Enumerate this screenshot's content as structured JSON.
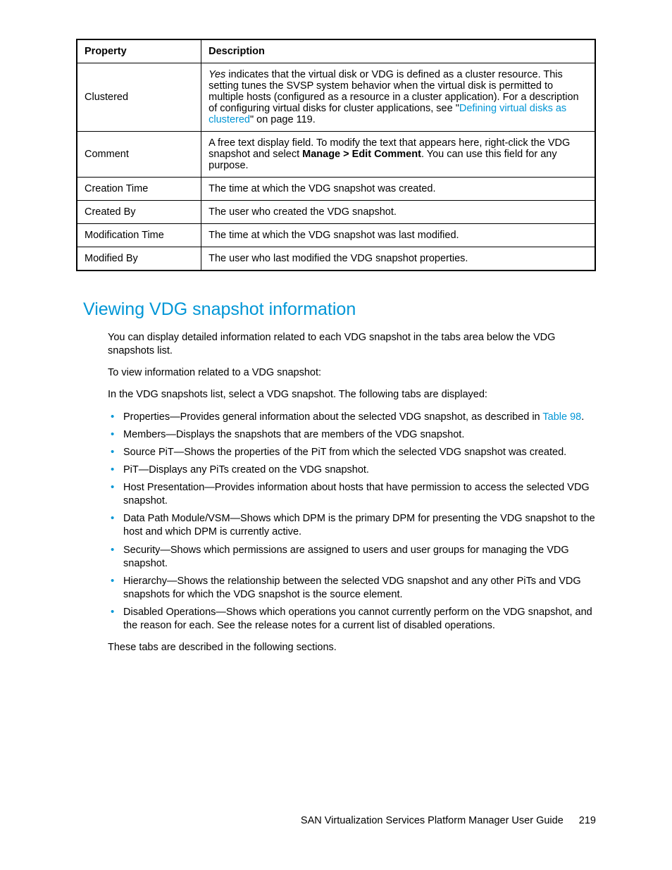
{
  "table": {
    "headers": {
      "property": "Property",
      "description": "Description"
    },
    "rows": [
      {
        "property": "Clustered",
        "desc_pre_italic": "Yes",
        "desc_pre": " indicates that the virtual disk or VDG is defined as a cluster resource. This setting tunes the SVSP system behavior when the virtual disk is permitted to multiple hosts (configured as a resource in a cluster application). For a description of configuring virtual disks for cluster applications, see \"",
        "desc_link": "Defining virtual disks as clustered",
        "desc_post": "\" on page 119."
      },
      {
        "property": "Comment",
        "desc_pre": "A free text display field. To modify the text that appears here, right-click the VDG snapshot and select ",
        "desc_bold": "Manage > Edit Comment",
        "desc_post": ". You can use this field for any purpose."
      },
      {
        "property": "Creation Time",
        "desc": "The time at which the VDG snapshot was created."
      },
      {
        "property": "Created By",
        "desc": "The user who created the VDG snapshot."
      },
      {
        "property": "Modification Time",
        "desc": "The time at which the VDG snapshot was last modified."
      },
      {
        "property": "Modified By",
        "desc": "The user who last modified the VDG snapshot properties."
      }
    ]
  },
  "heading": "Viewing VDG snapshot information",
  "para1": "You can display detailed information related to each VDG snapshot in the tabs area below the VDG snapshots list.",
  "para2": "To view information related to a VDG snapshot:",
  "para3": "In the VDG snapshots list, select a VDG snapshot. The following tabs are displayed:",
  "bullets": [
    {
      "pre": "Properties—Provides general information about the selected VDG snapshot, as described in ",
      "link": "Table 98",
      "post": "."
    },
    {
      "text": "Members—Displays the snapshots that are members of the VDG snapshot."
    },
    {
      "text": "Source PiT—Shows the properties of the PiT from which the selected VDG snapshot was created."
    },
    {
      "text": "PiT—Displays any PiTs created on the VDG snapshot."
    },
    {
      "text": "Host Presentation—Provides information about hosts that have permission to access the selected VDG snapshot."
    },
    {
      "text": "Data Path Module/VSM—Shows which DPM is the primary DPM for presenting the VDG snapshot to the host and which DPM is currently active."
    },
    {
      "text": "Security—Shows which permissions are assigned to users and user groups for managing the VDG snapshot."
    },
    {
      "text": "Hierarchy—Shows the relationship between the selected VDG snapshot and any other PiTs and VDG snapshots for which the VDG snapshot is the source element."
    },
    {
      "text": "Disabled Operations—Shows which operations you cannot currently perform on the VDG snapshot, and the reason for each. See the release notes for a current list of disabled operations."
    }
  ],
  "para4": "These tabs are described in the following sections.",
  "footer": {
    "title": "SAN Virtualization Services Platform Manager User Guide",
    "page": "219"
  }
}
